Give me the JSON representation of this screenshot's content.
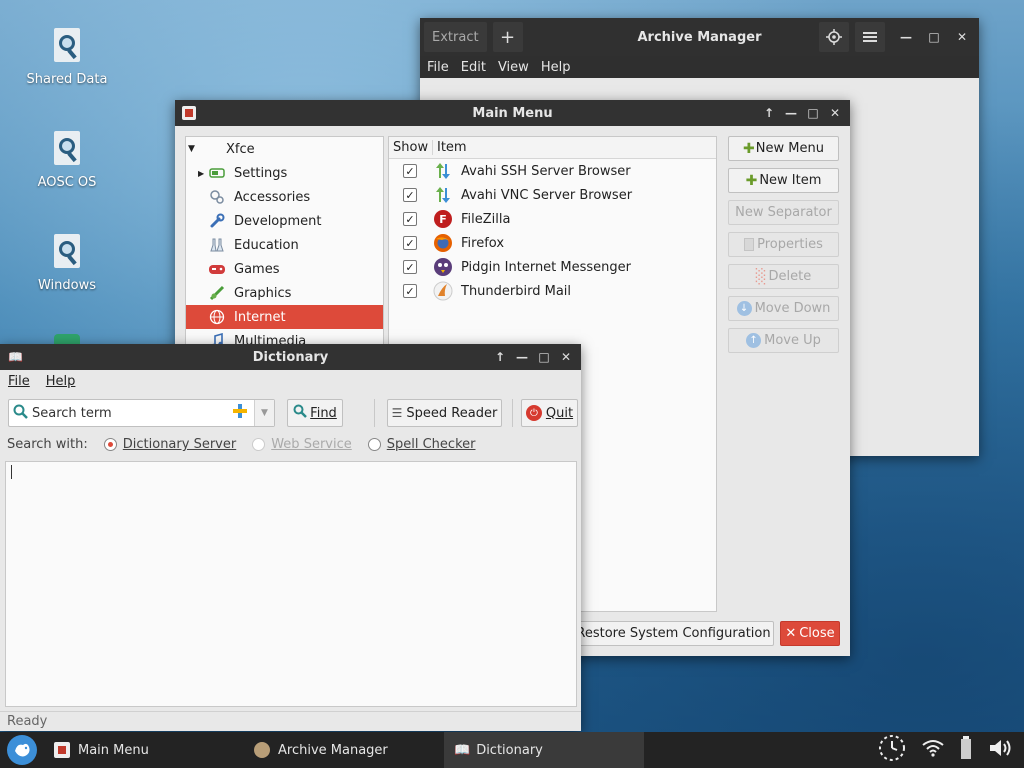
{
  "desktop": {
    "icons": [
      {
        "label": "Shared Data"
      },
      {
        "label": "AOSC OS"
      },
      {
        "label": "Windows"
      }
    ]
  },
  "archive_manager": {
    "title": "Archive Manager",
    "extract_label": "Extract",
    "add_label": "+",
    "menu": [
      "File",
      "Edit",
      "View",
      "Help"
    ]
  },
  "main_menu": {
    "title": "Main Menu",
    "tree": {
      "root": "Xfce",
      "items": [
        {
          "label": "Settings",
          "icon": "settings-icon"
        },
        {
          "label": "Accessories",
          "icon": "accessories-icon"
        },
        {
          "label": "Development",
          "icon": "wrench-icon"
        },
        {
          "label": "Education",
          "icon": "flask-icon"
        },
        {
          "label": "Games",
          "icon": "gamepad-icon"
        },
        {
          "label": "Graphics",
          "icon": "graphics-icon"
        },
        {
          "label": "Internet",
          "icon": "globe-icon",
          "selected": true
        },
        {
          "label": "Multimedia",
          "icon": "music-icon"
        }
      ]
    },
    "columns": {
      "show": "Show",
      "item": "Item"
    },
    "items": [
      {
        "label": "Avahi SSH Server Browser",
        "checked": true,
        "icon": "avahi-icon"
      },
      {
        "label": "Avahi VNC Server Browser",
        "checked": true,
        "icon": "avahi-icon"
      },
      {
        "label": "FileZilla",
        "checked": true,
        "icon": "filezilla-icon"
      },
      {
        "label": "Firefox",
        "checked": true,
        "icon": "firefox-icon"
      },
      {
        "label": "Pidgin Internet Messenger",
        "checked": true,
        "icon": "pidgin-icon"
      },
      {
        "label": "Thunderbird Mail",
        "checked": true,
        "icon": "thunderbird-icon"
      }
    ],
    "buttons": {
      "new_menu": "New Menu",
      "new_item": "New Item",
      "new_separator": "New Separator",
      "properties": "Properties",
      "delete": "Delete",
      "move_down": "Move Down",
      "move_up": "Move Up",
      "restore": "Restore System Configuration",
      "close": "Close"
    }
  },
  "dictionary": {
    "title": "Dictionary",
    "menu": {
      "file": "File",
      "help": "Help"
    },
    "search_placeholder": "Search term",
    "find": "Find",
    "speed_reader": "Speed Reader",
    "quit": "Quit",
    "search_with_label": "Search with:",
    "options": [
      {
        "label": "Dictionary Server",
        "selected": true,
        "disabled": false
      },
      {
        "label": "Web Service",
        "selected": false,
        "disabled": true
      },
      {
        "label": "Spell Checker",
        "selected": false,
        "disabled": false
      }
    ],
    "status": "Ready"
  },
  "taskbar": {
    "tasks": [
      {
        "label": "Main Menu"
      },
      {
        "label": "Archive Manager"
      },
      {
        "label": "Dictionary",
        "active": true
      }
    ]
  },
  "colors": {
    "accent": "#dd4a3a",
    "titlebar": "#323232",
    "taskbar": "#232323"
  }
}
